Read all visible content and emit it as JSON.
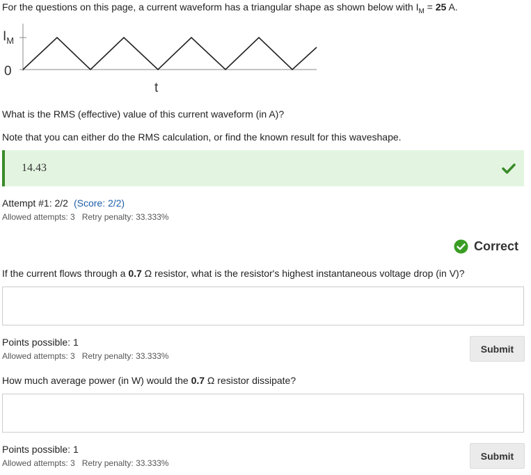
{
  "intro": {
    "text_before": "For the questions on this page, a current waveform has a triangular shape as shown below with ",
    "var_main": "I",
    "var_sub": "M",
    "equals": " = ",
    "value": "25",
    "unit": " A."
  },
  "waveform": {
    "y_label_main": "I",
    "y_label_sub": "M",
    "zero_label": "0",
    "x_label": "t",
    "line_color": "#222222"
  },
  "question1": {
    "text": "What is the RMS (effective) value of this current waveform (in A)?",
    "note": "Note that you can either do the RMS calculation, or find the known result for this waveshape.",
    "answer": "14.43",
    "attempt": "Attempt #1: 2/2",
    "score": "(Score: 2/2)",
    "allowed": "Allowed attempts: 3",
    "penalty": "Retry penalty: 33.333%",
    "status": "Correct",
    "accent_color": "#3a8a29"
  },
  "question2": {
    "text_before": "If the current flows through a ",
    "value": "0.7",
    "text_after": " Ω resistor, what is the resistor's highest instantaneous voltage drop (in V)?",
    "answer": "",
    "points": "Points possible: 1",
    "allowed": "Allowed attempts: 3",
    "penalty": "Retry penalty: 33.333%",
    "submit_label": "Submit"
  },
  "question3": {
    "text_before": "How much average power (in W) would the ",
    "value": "0.7",
    "text_after": " Ω resistor dissipate?",
    "answer": "",
    "points": "Points possible: 1",
    "allowed": "Allowed attempts: 3",
    "penalty": "Retry penalty: 33.333%",
    "submit_label": "Submit"
  }
}
